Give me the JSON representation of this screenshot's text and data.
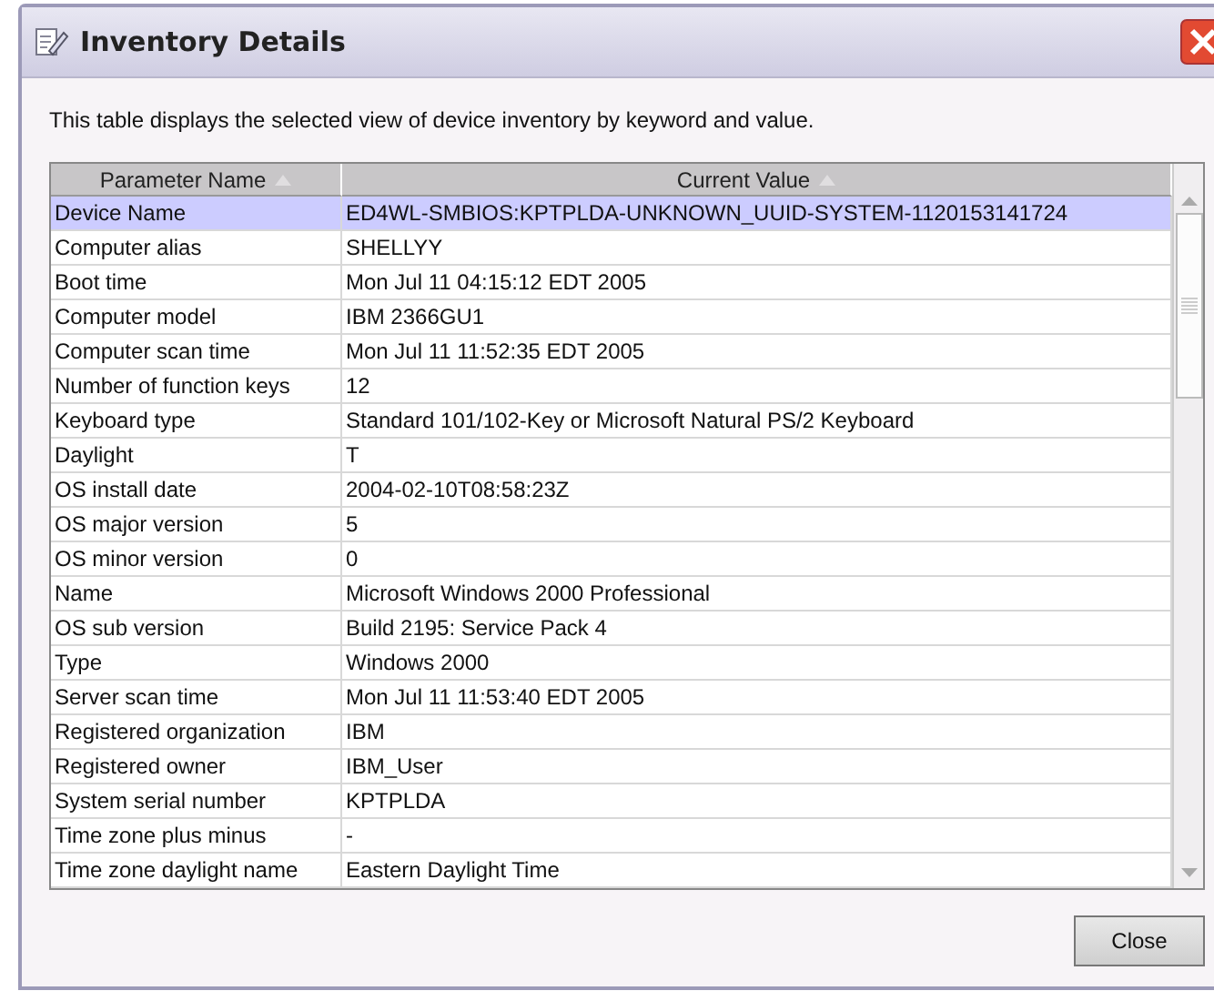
{
  "window": {
    "title": "Inventory Details"
  },
  "description": "This table displays the selected view of device inventory by keyword and value.",
  "table": {
    "columns": [
      {
        "label": "Parameter Name",
        "sorted": true
      },
      {
        "label": "Current Value",
        "sorted": true
      }
    ],
    "rows": [
      {
        "name": "Device Name",
        "value": "ED4WL-SMBIOS:KPTPLDA-UNKNOWN_UUID-SYSTEM-1120153141724",
        "selected": true
      },
      {
        "name": "Computer alias",
        "value": "SHELLYY",
        "selected": false
      },
      {
        "name": "Boot time",
        "value": "Mon Jul 11 04:15:12 EDT 2005",
        "selected": false
      },
      {
        "name": "Computer model",
        "value": "IBM 2366GU1",
        "selected": false
      },
      {
        "name": "Computer scan time",
        "value": "Mon Jul 11 11:52:35 EDT 2005",
        "selected": false
      },
      {
        "name": "Number of function keys",
        "value": "12",
        "selected": false
      },
      {
        "name": "Keyboard type",
        "value": "Standard 101/102-Key or Microsoft Natural PS/2 Keyboard",
        "selected": false
      },
      {
        "name": "Daylight",
        "value": "T",
        "selected": false
      },
      {
        "name": "OS install date",
        "value": "2004-02-10T08:58:23Z",
        "selected": false
      },
      {
        "name": "OS major version",
        "value": "5",
        "selected": false
      },
      {
        "name": "OS minor version",
        "value": "0",
        "selected": false
      },
      {
        "name": "Name",
        "value": "Microsoft Windows 2000 Professional",
        "selected": false
      },
      {
        "name": "OS sub version",
        "value": "Build 2195: Service Pack 4",
        "selected": false
      },
      {
        "name": "Type",
        "value": "Windows 2000",
        "selected": false
      },
      {
        "name": "Server scan time",
        "value": "Mon Jul 11 11:53:40 EDT 2005",
        "selected": false
      },
      {
        "name": "Registered organization",
        "value": "IBM",
        "selected": false
      },
      {
        "name": "Registered owner",
        "value": "IBM_User",
        "selected": false
      },
      {
        "name": "System serial number",
        "value": "KPTPLDA",
        "selected": false
      },
      {
        "name": "Time zone plus minus",
        "value": "-",
        "selected": false
      },
      {
        "name": "Time zone daylight name",
        "value": "Eastern Daylight Time",
        "selected": false
      }
    ]
  },
  "buttons": [
    {
      "label": "Close"
    }
  ]
}
